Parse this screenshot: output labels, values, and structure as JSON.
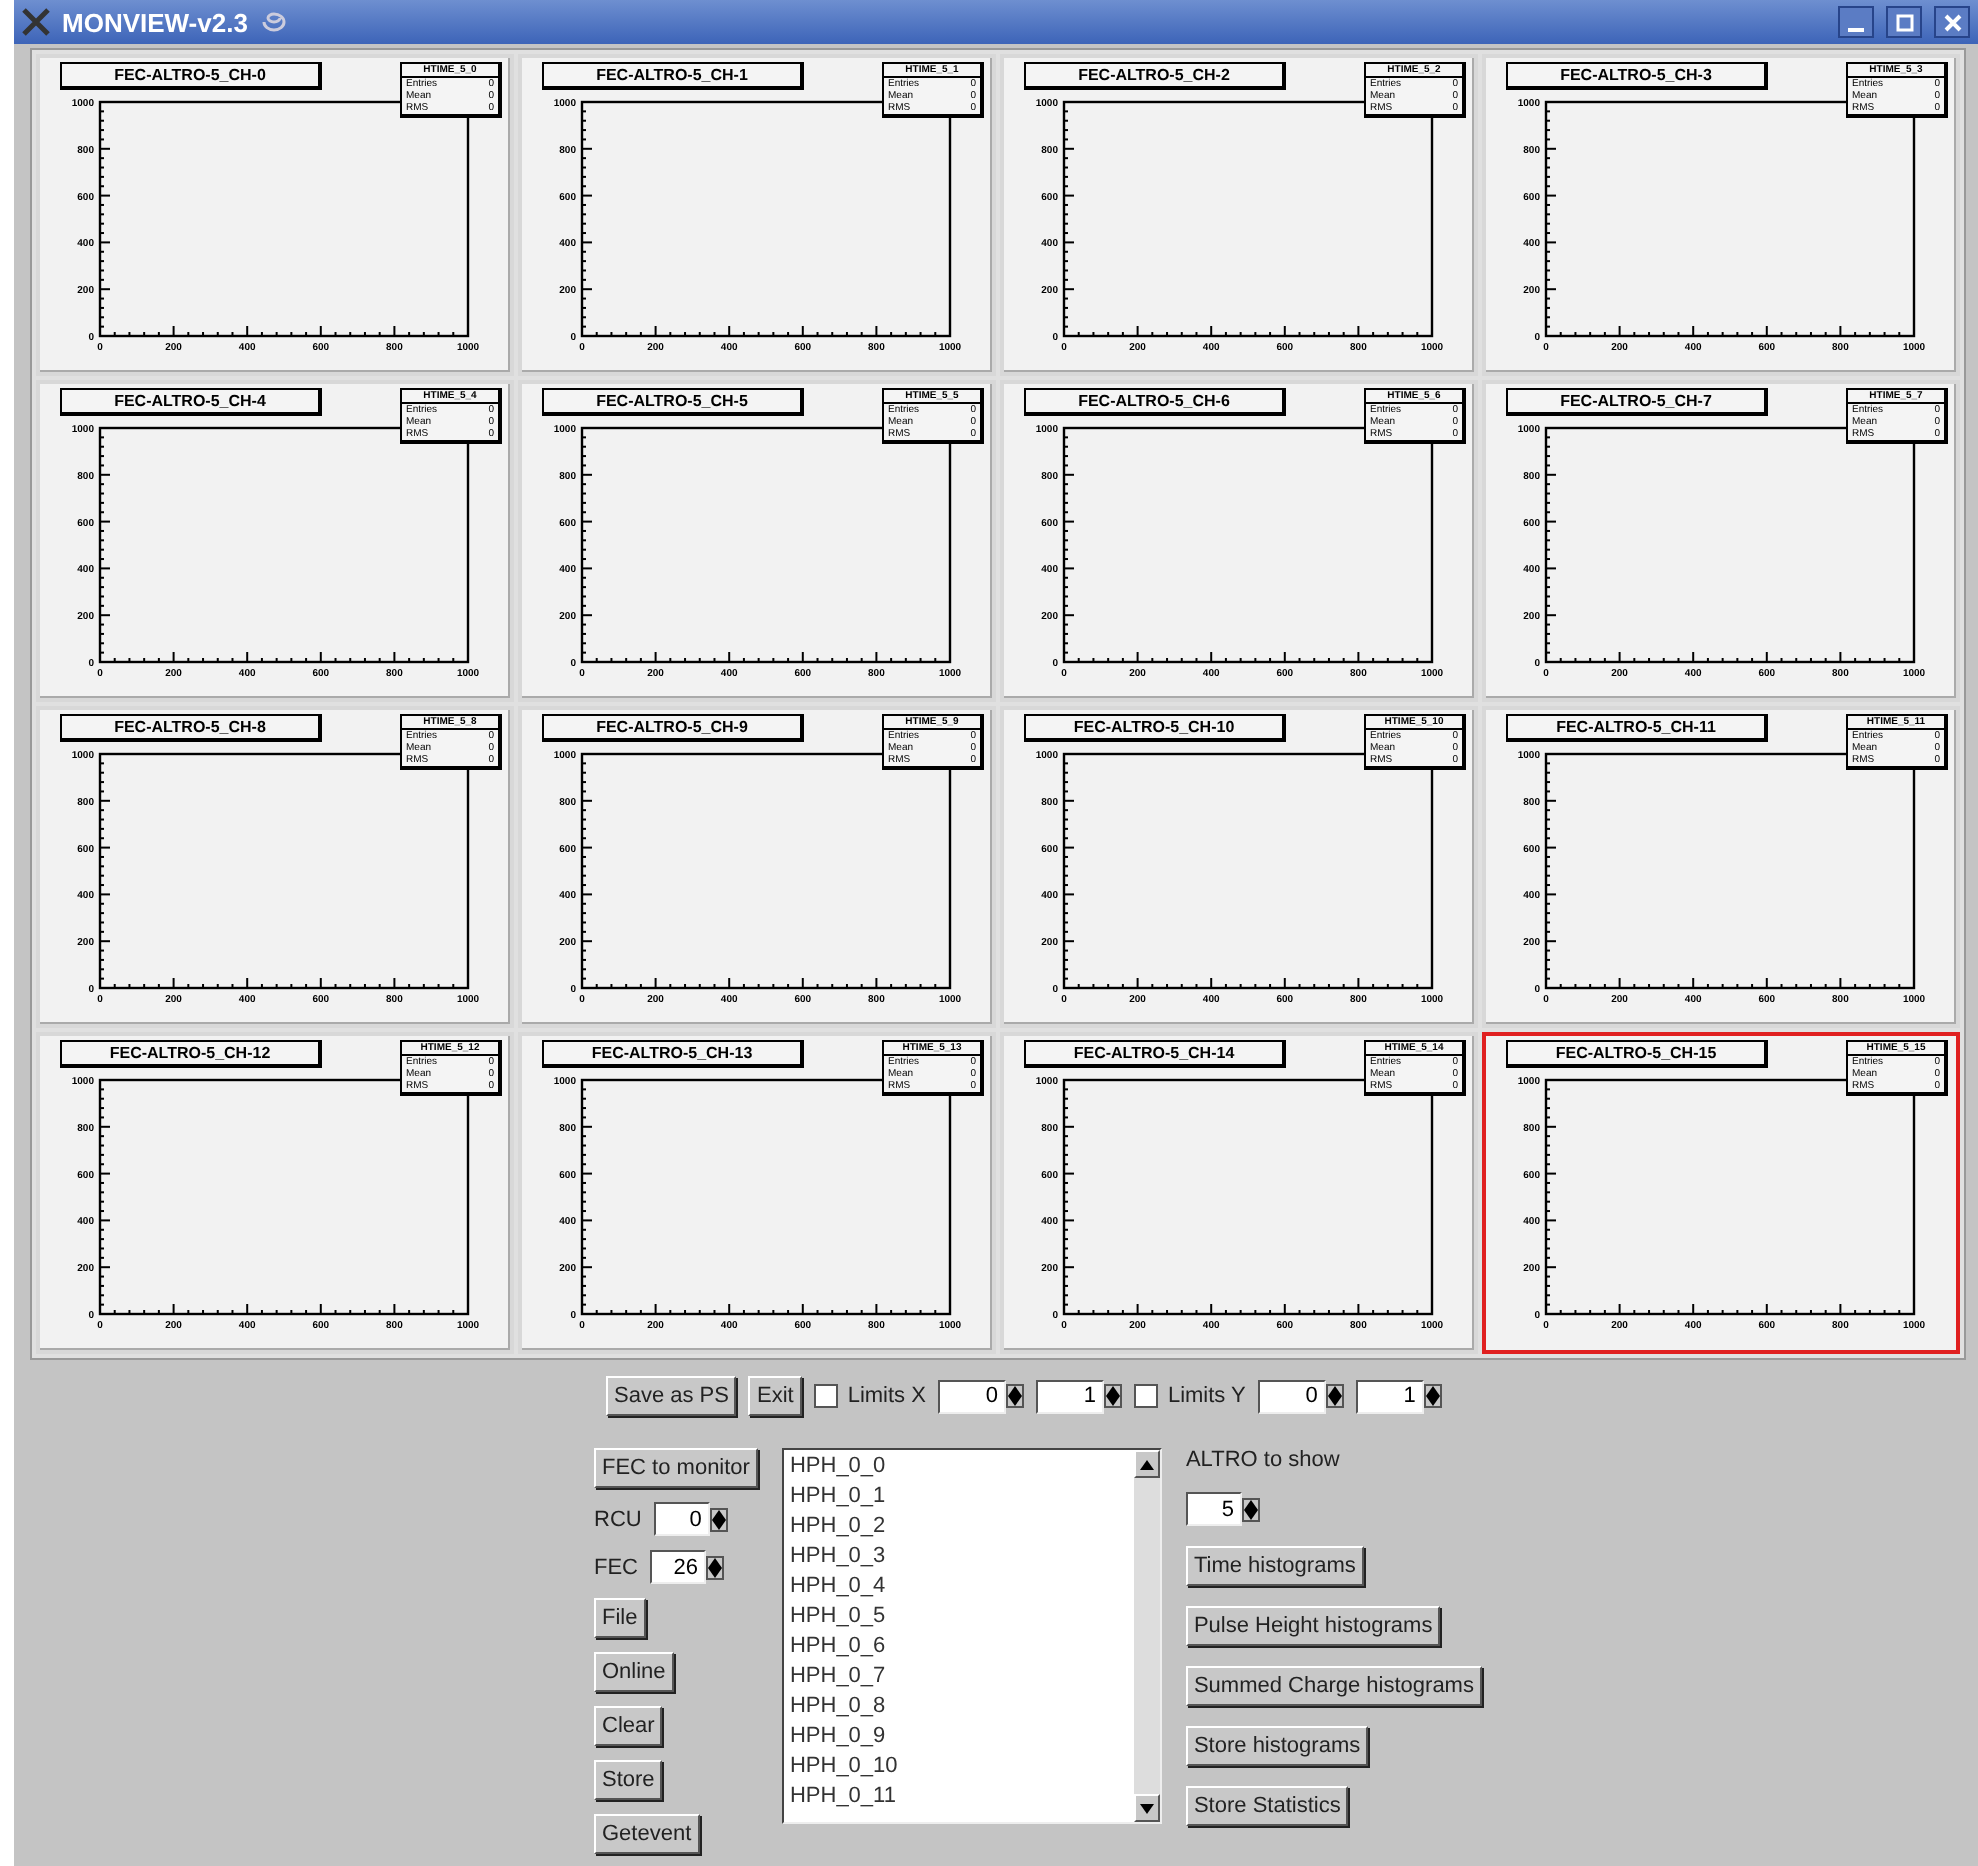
{
  "window": {
    "title": "MONVIEW-v2.3"
  },
  "pads": [
    {
      "title": "FEC-ALTRO-5_CH-0",
      "stats": {
        "name": "HTIME_5_0",
        "rows": [
          {
            "label": "Entries",
            "value": "0"
          },
          {
            "label": "Mean",
            "value": "0"
          },
          {
            "label": "RMS",
            "value": "0"
          }
        ]
      },
      "selected": false,
      "chart_data": {
        "type": "bar",
        "xlim": [
          0,
          1000
        ],
        "ylim": [
          0,
          1000
        ],
        "xticks": [
          0,
          200,
          400,
          600,
          800,
          1000
        ],
        "yticks": [
          0,
          200,
          400,
          600,
          800,
          1000
        ]
      }
    },
    {
      "title": "FEC-ALTRO-5_CH-1",
      "stats": {
        "name": "HTIME_5_1",
        "rows": [
          {
            "label": "Entries",
            "value": "0"
          },
          {
            "label": "Mean",
            "value": "0"
          },
          {
            "label": "RMS",
            "value": "0"
          }
        ]
      },
      "selected": false,
      "chart_data": {
        "type": "bar",
        "xlim": [
          0,
          1000
        ],
        "ylim": [
          0,
          1000
        ],
        "xticks": [
          0,
          200,
          400,
          600,
          800,
          1000
        ],
        "yticks": [
          0,
          200,
          400,
          600,
          800,
          1000
        ]
      }
    },
    {
      "title": "FEC-ALTRO-5_CH-2",
      "stats": {
        "name": "HTIME_5_2",
        "rows": [
          {
            "label": "Entries",
            "value": "0"
          },
          {
            "label": "Mean",
            "value": "0"
          },
          {
            "label": "RMS",
            "value": "0"
          }
        ]
      },
      "selected": false,
      "chart_data": {
        "type": "bar",
        "xlim": [
          0,
          1000
        ],
        "ylim": [
          0,
          1000
        ],
        "xticks": [
          0,
          200,
          400,
          600,
          800,
          1000
        ],
        "yticks": [
          0,
          200,
          400,
          600,
          800,
          1000
        ]
      }
    },
    {
      "title": "FEC-ALTRO-5_CH-3",
      "stats": {
        "name": "HTIME_5_3",
        "rows": [
          {
            "label": "Entries",
            "value": "0"
          },
          {
            "label": "Mean",
            "value": "0"
          },
          {
            "label": "RMS",
            "value": "0"
          }
        ]
      },
      "selected": false,
      "chart_data": {
        "type": "bar",
        "xlim": [
          0,
          1000
        ],
        "ylim": [
          0,
          1000
        ],
        "xticks": [
          0,
          200,
          400,
          600,
          800,
          1000
        ],
        "yticks": [
          0,
          200,
          400,
          600,
          800,
          1000
        ]
      }
    },
    {
      "title": "FEC-ALTRO-5_CH-4",
      "stats": {
        "name": "HTIME_5_4",
        "rows": [
          {
            "label": "Entries",
            "value": "0"
          },
          {
            "label": "Mean",
            "value": "0"
          },
          {
            "label": "RMS",
            "value": "0"
          }
        ]
      },
      "selected": false,
      "chart_data": {
        "type": "bar",
        "xlim": [
          0,
          1000
        ],
        "ylim": [
          0,
          1000
        ],
        "xticks": [
          0,
          200,
          400,
          600,
          800,
          1000
        ],
        "yticks": [
          0,
          200,
          400,
          600,
          800,
          1000
        ]
      }
    },
    {
      "title": "FEC-ALTRO-5_CH-5",
      "stats": {
        "name": "HTIME_5_5",
        "rows": [
          {
            "label": "Entries",
            "value": "0"
          },
          {
            "label": "Mean",
            "value": "0"
          },
          {
            "label": "RMS",
            "value": "0"
          }
        ]
      },
      "selected": false,
      "chart_data": {
        "type": "bar",
        "xlim": [
          0,
          1000
        ],
        "ylim": [
          0,
          1000
        ],
        "xticks": [
          0,
          200,
          400,
          600,
          800,
          1000
        ],
        "yticks": [
          0,
          200,
          400,
          600,
          800,
          1000
        ]
      }
    },
    {
      "title": "FEC-ALTRO-5_CH-6",
      "stats": {
        "name": "HTIME_5_6",
        "rows": [
          {
            "label": "Entries",
            "value": "0"
          },
          {
            "label": "Mean",
            "value": "0"
          },
          {
            "label": "RMS",
            "value": "0"
          }
        ]
      },
      "selected": false,
      "chart_data": {
        "type": "bar",
        "xlim": [
          0,
          1000
        ],
        "ylim": [
          0,
          1000
        ],
        "xticks": [
          0,
          200,
          400,
          600,
          800,
          1000
        ],
        "yticks": [
          0,
          200,
          400,
          600,
          800,
          1000
        ]
      }
    },
    {
      "title": "FEC-ALTRO-5_CH-7",
      "stats": {
        "name": "HTIME_5_7",
        "rows": [
          {
            "label": "Entries",
            "value": "0"
          },
          {
            "label": "Mean",
            "value": "0"
          },
          {
            "label": "RMS",
            "value": "0"
          }
        ]
      },
      "selected": false,
      "chart_data": {
        "type": "bar",
        "xlim": [
          0,
          1000
        ],
        "ylim": [
          0,
          1000
        ],
        "xticks": [
          0,
          200,
          400,
          600,
          800,
          1000
        ],
        "yticks": [
          0,
          200,
          400,
          600,
          800,
          1000
        ]
      }
    },
    {
      "title": "FEC-ALTRO-5_CH-8",
      "stats": {
        "name": "HTIME_5_8",
        "rows": [
          {
            "label": "Entries",
            "value": "0"
          },
          {
            "label": "Mean",
            "value": "0"
          },
          {
            "label": "RMS",
            "value": "0"
          }
        ]
      },
      "selected": false,
      "chart_data": {
        "type": "bar",
        "xlim": [
          0,
          1000
        ],
        "ylim": [
          0,
          1000
        ],
        "xticks": [
          0,
          200,
          400,
          600,
          800,
          1000
        ],
        "yticks": [
          0,
          200,
          400,
          600,
          800,
          1000
        ]
      }
    },
    {
      "title": "FEC-ALTRO-5_CH-9",
      "stats": {
        "name": "HTIME_5_9",
        "rows": [
          {
            "label": "Entries",
            "value": "0"
          },
          {
            "label": "Mean",
            "value": "0"
          },
          {
            "label": "RMS",
            "value": "0"
          }
        ]
      },
      "selected": false,
      "chart_data": {
        "type": "bar",
        "xlim": [
          0,
          1000
        ],
        "ylim": [
          0,
          1000
        ],
        "xticks": [
          0,
          200,
          400,
          600,
          800,
          1000
        ],
        "yticks": [
          0,
          200,
          400,
          600,
          800,
          1000
        ]
      }
    },
    {
      "title": "FEC-ALTRO-5_CH-10",
      "stats": {
        "name": "HTIME_5_10",
        "rows": [
          {
            "label": "Entries",
            "value": "0"
          },
          {
            "label": "Mean",
            "value": "0"
          },
          {
            "label": "RMS",
            "value": "0"
          }
        ]
      },
      "selected": false,
      "chart_data": {
        "type": "bar",
        "xlim": [
          0,
          1000
        ],
        "ylim": [
          0,
          1000
        ],
        "xticks": [
          0,
          200,
          400,
          600,
          800,
          1000
        ],
        "yticks": [
          0,
          200,
          400,
          600,
          800,
          1000
        ]
      }
    },
    {
      "title": "FEC-ALTRO-5_CH-11",
      "stats": {
        "name": "HTIME_5_11",
        "rows": [
          {
            "label": "Entries",
            "value": "0"
          },
          {
            "label": "Mean",
            "value": "0"
          },
          {
            "label": "RMS",
            "value": "0"
          }
        ]
      },
      "selected": false,
      "chart_data": {
        "type": "bar",
        "xlim": [
          0,
          1000
        ],
        "ylim": [
          0,
          1000
        ],
        "xticks": [
          0,
          200,
          400,
          600,
          800,
          1000
        ],
        "yticks": [
          0,
          200,
          400,
          600,
          800,
          1000
        ]
      }
    },
    {
      "title": "FEC-ALTRO-5_CH-12",
      "stats": {
        "name": "HTIME_5_12",
        "rows": [
          {
            "label": "Entries",
            "value": "0"
          },
          {
            "label": "Mean",
            "value": "0"
          },
          {
            "label": "RMS",
            "value": "0"
          }
        ]
      },
      "selected": false,
      "chart_data": {
        "type": "bar",
        "xlim": [
          0,
          1000
        ],
        "ylim": [
          0,
          1000
        ],
        "xticks": [
          0,
          200,
          400,
          600,
          800,
          1000
        ],
        "yticks": [
          0,
          200,
          400,
          600,
          800,
          1000
        ]
      }
    },
    {
      "title": "FEC-ALTRO-5_CH-13",
      "stats": {
        "name": "HTIME_5_13",
        "rows": [
          {
            "label": "Entries",
            "value": "0"
          },
          {
            "label": "Mean",
            "value": "0"
          },
          {
            "label": "RMS",
            "value": "0"
          }
        ]
      },
      "selected": false,
      "chart_data": {
        "type": "bar",
        "xlim": [
          0,
          1000
        ],
        "ylim": [
          0,
          1000
        ],
        "xticks": [
          0,
          200,
          400,
          600,
          800,
          1000
        ],
        "yticks": [
          0,
          200,
          400,
          600,
          800,
          1000
        ]
      }
    },
    {
      "title": "FEC-ALTRO-5_CH-14",
      "stats": {
        "name": "HTIME_5_14",
        "rows": [
          {
            "label": "Entries",
            "value": "0"
          },
          {
            "label": "Mean",
            "value": "0"
          },
          {
            "label": "RMS",
            "value": "0"
          }
        ]
      },
      "selected": false,
      "chart_data": {
        "type": "bar",
        "xlim": [
          0,
          1000
        ],
        "ylim": [
          0,
          1000
        ],
        "xticks": [
          0,
          200,
          400,
          600,
          800,
          1000
        ],
        "yticks": [
          0,
          200,
          400,
          600,
          800,
          1000
        ]
      }
    },
    {
      "title": "FEC-ALTRO-5_CH-15",
      "stats": {
        "name": "HTIME_5_15",
        "rows": [
          {
            "label": "Entries",
            "value": "0"
          },
          {
            "label": "Mean",
            "value": "0"
          },
          {
            "label": "RMS",
            "value": "0"
          }
        ]
      },
      "selected": true,
      "chart_data": {
        "type": "bar",
        "xlim": [
          0,
          1000
        ],
        "ylim": [
          0,
          1000
        ],
        "xticks": [
          0,
          200,
          400,
          600,
          800,
          1000
        ],
        "yticks": [
          0,
          200,
          400,
          600,
          800,
          1000
        ]
      }
    }
  ],
  "toolbar": [
    {
      "kind": "button",
      "label": "Save as PS"
    },
    {
      "kind": "button",
      "label": "Exit"
    },
    {
      "kind": "checkbox",
      "label": "Limits X",
      "checked": false
    },
    {
      "kind": "spinner",
      "value": "0"
    },
    {
      "kind": "spinner",
      "value": "1"
    },
    {
      "kind": "checkbox",
      "label": "Limits Y",
      "checked": false
    },
    {
      "kind": "spinner",
      "value": "0"
    },
    {
      "kind": "spinner",
      "value": "1"
    }
  ],
  "left_controls": [
    {
      "kind": "button",
      "label": "FEC to monitor"
    },
    {
      "kind": "spinner",
      "label": "RCU",
      "value": "0"
    },
    {
      "kind": "spinner",
      "label": "FEC",
      "value": "26"
    },
    {
      "kind": "button",
      "label": "File"
    },
    {
      "kind": "button",
      "label": "Online"
    },
    {
      "kind": "button",
      "label": "Clear"
    },
    {
      "kind": "button",
      "label": "Store"
    },
    {
      "kind": "button",
      "label": "Getevent"
    }
  ],
  "histogram_list": [
    "HPH_0_0",
    "HPH_0_1",
    "HPH_0_2",
    "HPH_0_3",
    "HPH_0_4",
    "HPH_0_5",
    "HPH_0_6",
    "HPH_0_7",
    "HPH_0_8",
    "HPH_0_9",
    "HPH_0_10",
    "HPH_0_11"
  ],
  "right_controls": [
    {
      "kind": "label",
      "label": "ALTRO to show"
    },
    {
      "kind": "spinner",
      "value": "5"
    },
    {
      "kind": "button",
      "label": "Time histograms"
    },
    {
      "kind": "button",
      "label": "Pulse Height histograms"
    },
    {
      "kind": "button",
      "label": "Summed Charge histograms"
    },
    {
      "kind": "button",
      "label": "Store histograms"
    },
    {
      "kind": "button",
      "label": "Store Statistics"
    }
  ]
}
